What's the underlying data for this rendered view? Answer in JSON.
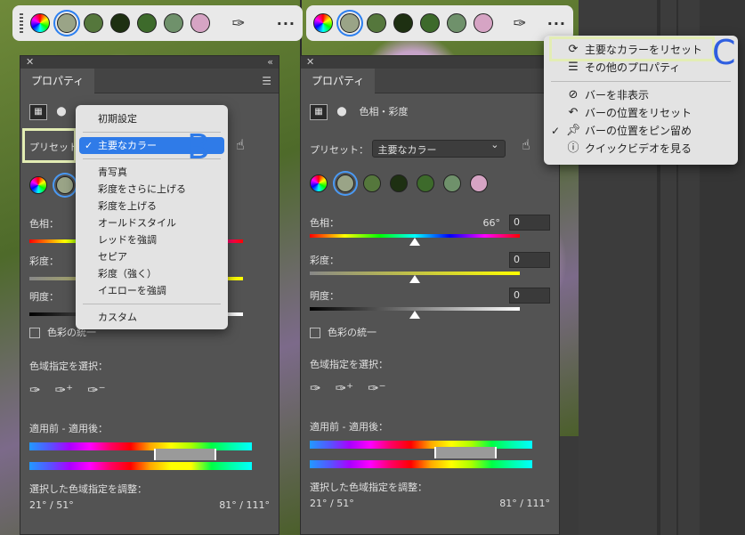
{
  "colors": {
    "accent": "#2f7be8",
    "highlight_box": "#e3edb4",
    "label_b": "#2f7be8",
    "label_c": "#2f5fe0"
  },
  "taskbar": {
    "swatches": [
      "color-wheel",
      "#9aa487",
      "#55773c",
      "#1e3012",
      "#3d6a2b",
      "#6f916b",
      "#d6a4c4"
    ],
    "selected_swatch_index": 1,
    "eyedropper_icon": "eyedropper-icon",
    "more_label": "···"
  },
  "left_panel": {
    "title": "プロパティ",
    "preset_label": "プリセット",
    "hue_label": "色相：",
    "saturation_label": "彩度：",
    "lightness_label": "明度：",
    "colorize_label": "色彩の統一",
    "color_range_label": "色域指定を選択：",
    "before_after_label": "適用前 - 適用後：",
    "adjust_label": "選択した色域指定を調整：",
    "range_left": "21° / 51°",
    "range_right": "81° / 111°"
  },
  "dropdown": {
    "items": [
      "初期設定",
      "主要なカラー",
      "青写真",
      "彩度をさらに上げる",
      "彩度を上げる",
      "オールドスタイル",
      "レッドを強調",
      "セピア",
      "彩度（強く）",
      "イエローを強調",
      "カスタム"
    ],
    "selected_index": 1,
    "annotation": "B"
  },
  "right_panel": {
    "title": "プロパティ",
    "sub_title": "色相・彩度",
    "preset_label": "プリセット：",
    "preset_value": "主要なカラー",
    "hue_label": "色相：",
    "hue_degree": "66°",
    "hue_value": "0",
    "saturation_label": "彩度：",
    "saturation_value": "0",
    "lightness_label": "明度：",
    "lightness_value": "0",
    "colorize_label": "色彩の統一",
    "color_range_label": "色域指定を選択：",
    "before_after_label": "適用前 - 適用後：",
    "adjust_label": "選択した色域指定を調整：",
    "range_left": "21° / 51°",
    "range_right": "81° / 111°"
  },
  "more_menu": {
    "items": [
      {
        "label": "主要なカラーをリセット",
        "icon": "refresh-icon",
        "checked": false
      },
      {
        "label": "その他のプロパティ",
        "icon": "sliders-icon",
        "checked": false
      },
      {
        "label": "バーを非表示",
        "icon": "eye-hidden-icon",
        "checked": false
      },
      {
        "label": "バーの位置をリセット",
        "icon": "undo-icon",
        "checked": false
      },
      {
        "label": "バーの位置をピン留め",
        "icon": "pin-icon",
        "checked": true
      },
      {
        "label": "クイックビデオを見る",
        "icon": "info-icon",
        "checked": false
      }
    ],
    "annotation": "C"
  }
}
